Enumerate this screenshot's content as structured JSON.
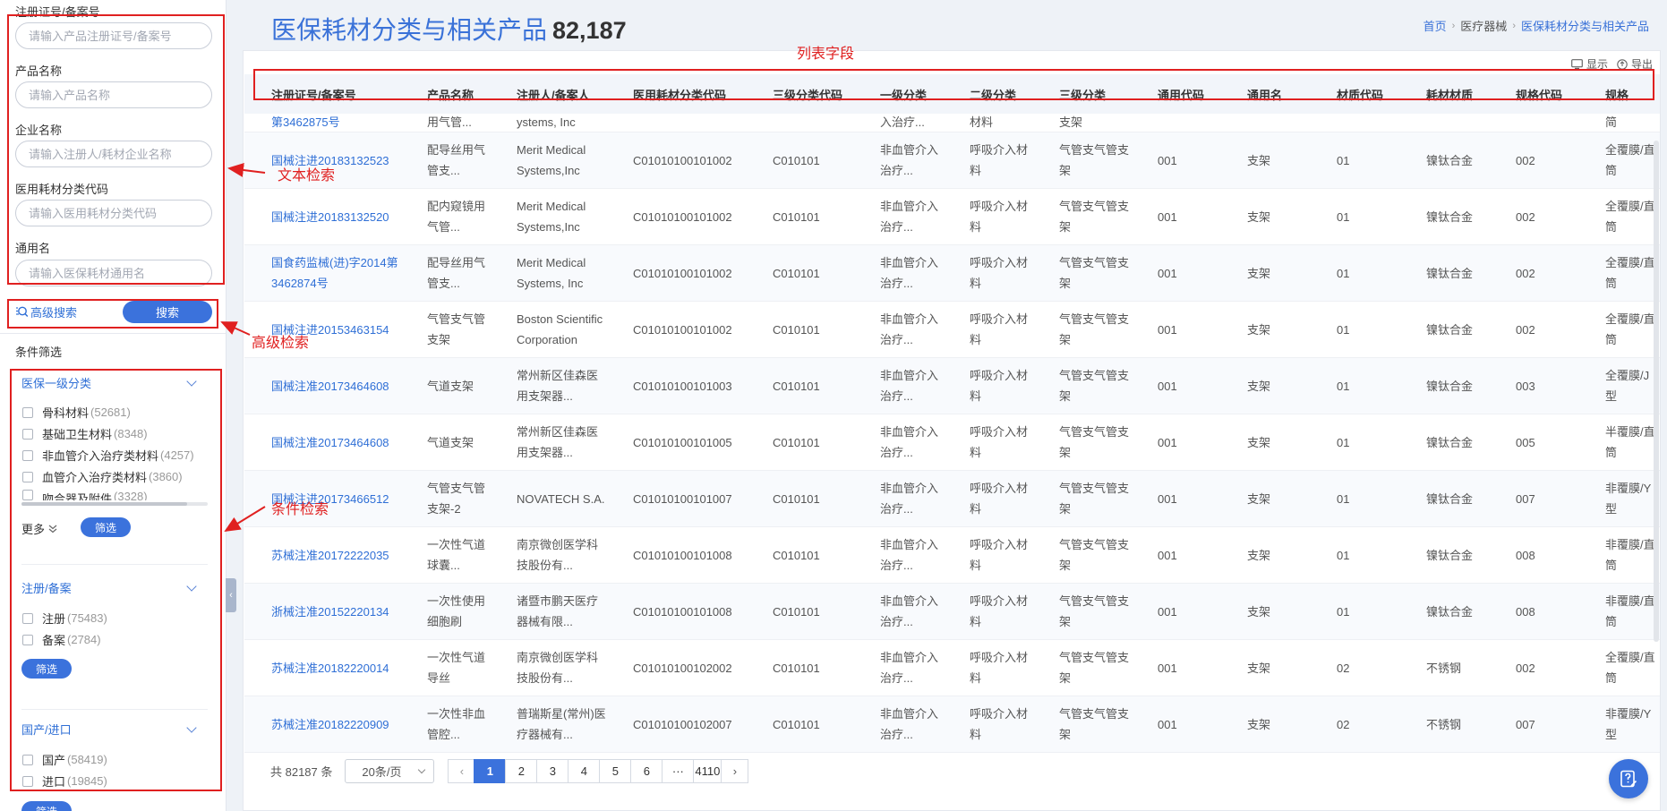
{
  "sidebar": {
    "fields": [
      {
        "label": "注册证号/备案号",
        "placeholder": "请输入产品注册证号/备案号"
      },
      {
        "label": "产品名称",
        "placeholder": "请输入产品名称"
      },
      {
        "label": "企业名称",
        "placeholder": "请输入注册人/耗材企业名称"
      },
      {
        "label": "医用耗材分类代码",
        "placeholder": "请输入医用耗材分类代码"
      },
      {
        "label": "通用名",
        "placeholder": "请输入医保耗材通用名"
      }
    ],
    "advanced_search_label": "高级搜索",
    "search_button_label": "搜索",
    "filter_section_title": "条件筛选",
    "groups": [
      {
        "title": "医保一级分类",
        "options": [
          {
            "label": "骨科材料",
            "count": "(52681)"
          },
          {
            "label": "基础卫生材料",
            "count": "(8348)"
          },
          {
            "label": "非血管介入治疗类材料",
            "count": "(4257)"
          },
          {
            "label": "血管介入治疗类材料",
            "count": "(3860)"
          },
          {
            "label": "吻合器及附件",
            "count": "(3328)"
          }
        ],
        "more_label": "更多",
        "filter_button_label": "筛选"
      },
      {
        "title": "注册/备案",
        "options": [
          {
            "label": "注册",
            "count": "(75483)"
          },
          {
            "label": "备案",
            "count": "(2784)"
          }
        ],
        "filter_button_label": "筛选"
      },
      {
        "title": "国产/进口",
        "options": [
          {
            "label": "国产",
            "count": "(58419)"
          },
          {
            "label": "进口",
            "count": "(19845)"
          }
        ],
        "filter_button_label": "筛选"
      }
    ]
  },
  "header": {
    "title": "医保耗材分类与相关产品",
    "count": "82,187",
    "breadcrumb": [
      "首页",
      "医疗器械",
      "医保耗材分类与相关产品"
    ]
  },
  "toolbar": {
    "display_label": "显示",
    "export_label": "导出"
  },
  "table": {
    "columns": [
      "注册证号/备案号",
      "产品名称",
      "注册人/备案人",
      "医用耗材分类代码",
      "三级分类代码",
      "一级分类",
      "二级分类",
      "三级分类",
      "通用代码",
      "通用名",
      "材质代码",
      "耗材材质",
      "规格代码",
      "规格"
    ],
    "partial_row": [
      "第3462875号",
      "用气管...",
      "ystems, Inc",
      "",
      "",
      "入治疗...",
      "材料",
      "支架",
      "",
      "",
      "",
      "",
      "",
      "简"
    ],
    "rows": [
      [
        "国械注进20183132523",
        "配导丝用气管支...",
        "Merit Medical Systems,Inc",
        "C01010100101002",
        "C010101",
        "非血管介入治疗...",
        "呼吸介入材料",
        "气管支气管支架",
        "001",
        "支架",
        "01",
        "镍钛合金",
        "002",
        "全覆膜/直筒"
      ],
      [
        "国械注进20183132520",
        "配内窥镜用气管...",
        "Merit Medical Systems,Inc",
        "C01010100101002",
        "C010101",
        "非血管介入治疗...",
        "呼吸介入材料",
        "气管支气管支架",
        "001",
        "支架",
        "01",
        "镍钛合金",
        "002",
        "全覆膜/直筒"
      ],
      [
        "国食药监械(进)字2014第3462874号",
        "配导丝用气管支...",
        "Merit Medical Systems, Inc",
        "C01010100101002",
        "C010101",
        "非血管介入治疗...",
        "呼吸介入材料",
        "气管支气管支架",
        "001",
        "支架",
        "01",
        "镍钛合金",
        "002",
        "全覆膜/直筒"
      ],
      [
        "国械注进20153463154",
        "气管支气管支架",
        "Boston Scientific Corporation",
        "C01010100101002",
        "C010101",
        "非血管介入治疗...",
        "呼吸介入材料",
        "气管支气管支架",
        "001",
        "支架",
        "01",
        "镍钛合金",
        "002",
        "全覆膜/直筒"
      ],
      [
        "国械注准20173464608",
        "气道支架",
        "常州新区佳森医用支架器...",
        "C01010100101003",
        "C010101",
        "非血管介入治疗...",
        "呼吸介入材料",
        "气管支气管支架",
        "001",
        "支架",
        "01",
        "镍钛合金",
        "003",
        "全覆膜/J型"
      ],
      [
        "国械注准20173464608",
        "气道支架",
        "常州新区佳森医用支架器...",
        "C01010100101005",
        "C010101",
        "非血管介入治疗...",
        "呼吸介入材料",
        "气管支气管支架",
        "001",
        "支架",
        "01",
        "镍钛合金",
        "005",
        "半覆膜/直筒"
      ],
      [
        "国械注进20173466512",
        "气管支气管支架-2",
        "NOVATECH S.A.",
        "C01010100101007",
        "C010101",
        "非血管介入治疗...",
        "呼吸介入材料",
        "气管支气管支架",
        "001",
        "支架",
        "01",
        "镍钛合金",
        "007",
        "非覆膜/Y型"
      ],
      [
        "苏械注准20172222035",
        "一次性气道球囊...",
        "南京微创医学科技股份有...",
        "C01010100101008",
        "C010101",
        "非血管介入治疗...",
        "呼吸介入材料",
        "气管支气管支架",
        "001",
        "支架",
        "01",
        "镍钛合金",
        "008",
        "非覆膜/直筒"
      ],
      [
        "浙械注准20152220134",
        "一次性使用细胞刷",
        "诸暨市鹏天医疗器械有限...",
        "C01010100101008",
        "C010101",
        "非血管介入治疗...",
        "呼吸介入材料",
        "气管支气管支架",
        "001",
        "支架",
        "01",
        "镍钛合金",
        "008",
        "非覆膜/直筒"
      ],
      [
        "苏械注准20182220014",
        "一次性气道导丝",
        "南京微创医学科技股份有...",
        "C01010100102002",
        "C010101",
        "非血管介入治疗...",
        "呼吸介入材料",
        "气管支气管支架",
        "001",
        "支架",
        "02",
        "不锈钢",
        "002",
        "全覆膜/直筒"
      ],
      [
        "苏械注准20182220909",
        "一次性非血管腔...",
        "普瑞斯星(常州)医疗器械有...",
        "C01010100102007",
        "C010101",
        "非血管介入治疗...",
        "呼吸介入材料",
        "气管支气管支架",
        "001",
        "支架",
        "02",
        "不锈钢",
        "007",
        "非覆膜/Y型"
      ]
    ]
  },
  "pagination": {
    "total": "共 82187 条",
    "page_size": "20条/页",
    "pages": [
      "1",
      "2",
      "3",
      "4",
      "5",
      "6",
      "···",
      "4110"
    ],
    "current": "1"
  },
  "annotations": {
    "list_fields": "列表字段",
    "text_search": "文本检索",
    "advanced_search": "高级检索",
    "condition_search": "条件检索"
  },
  "colors": {
    "accent": "#3b72dc",
    "annotation": "#e02020",
    "link": "#2f6fd6"
  }
}
